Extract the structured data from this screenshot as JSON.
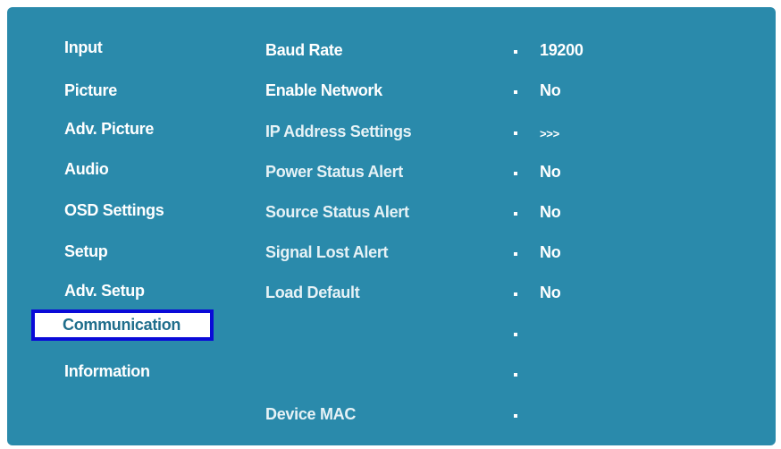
{
  "sidebar": {
    "items": [
      {
        "label": "Input"
      },
      {
        "label": "Picture"
      },
      {
        "label": "Adv. Picture"
      },
      {
        "label": "Audio"
      },
      {
        "label": "OSD Settings"
      },
      {
        "label": "Setup"
      },
      {
        "label": "Adv. Setup"
      },
      {
        "label": "Communication",
        "selected": true
      },
      {
        "label": "Information"
      }
    ]
  },
  "settings": {
    "rows": [
      {
        "label": "Baud Rate",
        "value": "19200"
      },
      {
        "label": "Enable Network",
        "value": "No"
      },
      {
        "label": "IP Address Settings",
        "value": ">>>"
      },
      {
        "label": "Power Status Alert",
        "value": "No"
      },
      {
        "label": "Source Status Alert",
        "value": "No"
      },
      {
        "label": "Signal Lost Alert",
        "value": "No"
      },
      {
        "label": "Load Default",
        "value": "No"
      },
      {
        "label": "",
        "value": ""
      },
      {
        "label": "",
        "value": ""
      },
      {
        "label": "Device MAC",
        "value": ""
      }
    ]
  },
  "colors": {
    "panel_background": "#2a8aab",
    "selection_border": "#0a0ad8",
    "selection_fill": "#ffffff",
    "selected_text": "#1f6e8c",
    "text": "#ffffff"
  }
}
